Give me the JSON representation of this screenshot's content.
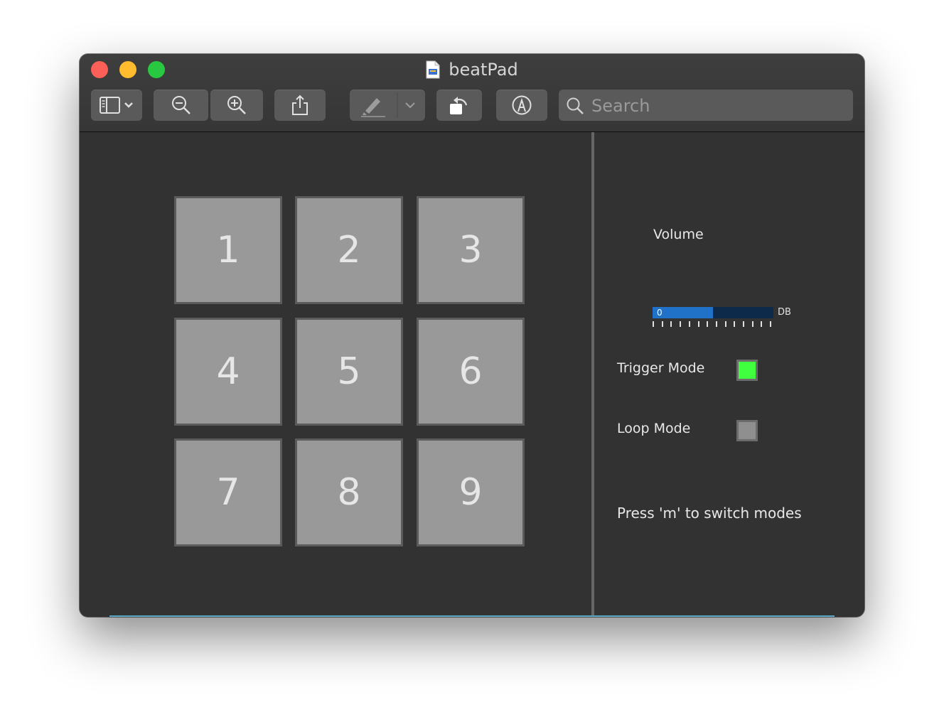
{
  "window": {
    "title": "beatPad"
  },
  "toolbar": {
    "search_placeholder": "Search"
  },
  "pads": [
    "1",
    "2",
    "3",
    "4",
    "5",
    "6",
    "7",
    "8",
    "9"
  ],
  "volume": {
    "label": "Volume",
    "value_text": "0",
    "unit": "DB",
    "level_fraction": 0.5
  },
  "modes": {
    "trigger": {
      "label": "Trigger Mode",
      "active": true,
      "color": "#3fff3f"
    },
    "loop": {
      "label": "Loop Mode",
      "active": false,
      "color": "#8f8f8f"
    }
  },
  "hint": "Press 'm' to switch modes"
}
